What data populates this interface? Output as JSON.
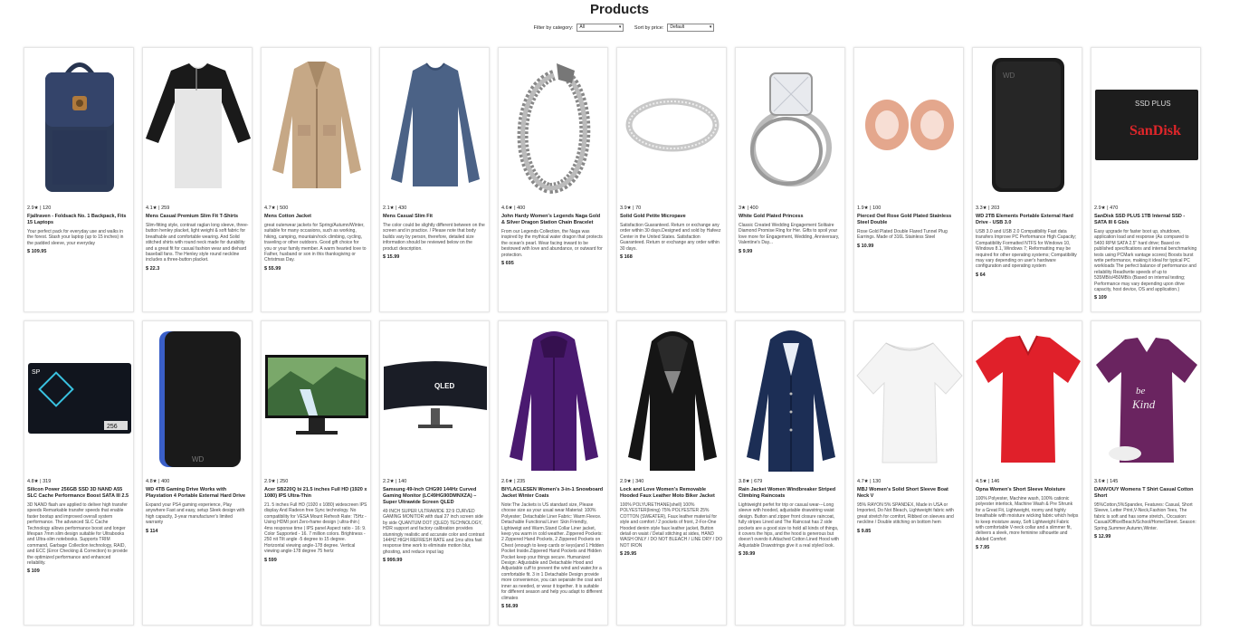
{
  "page": {
    "title": "Products"
  },
  "filters": {
    "category_label": "Filter by category:",
    "category_value": "All",
    "sort_label": "Sort by price:",
    "sort_value": "Default"
  },
  "products": [
    {
      "rating": "2.9★",
      "reviews": "120",
      "title": "Fjallraven - Foldsack No. 1 Backpack, Fits 15 Laptops",
      "desc": "Your perfect pack for everyday use and walks in the forest. Stash your laptop (up to 15 inches) in the padded sleeve, your everyday",
      "price": "$ 109.95",
      "img": "backpack"
    },
    {
      "rating": "4.1★",
      "reviews": "259",
      "title": "Mens Casual Premium Slim Fit T-Shirts",
      "desc": "Slim-fitting style, contrast raglan long sleeve, three-button henley placket, light weight & soft fabric for breathable and comfortable wearing. And Solid stitched shirts with round neck made for durability and a great fit for casual fashion wear and diehard baseball fans. The Henley style round neckline includes a three-button placket.",
      "price": "$ 22.3",
      "img": "raglan"
    },
    {
      "rating": "4.7★",
      "reviews": "500",
      "title": "Mens Cotton Jacket",
      "desc": "great outerwear jackets for Spring/Autumn/Winter, suitable for many occasions, such as working, hiking, camping, mountain/rock climbing, cycling, traveling or other outdoors. Good gift choice for you or your family member. A warm hearted love to Father, husband or son in this thanksgiving or Christmas Day.",
      "price": "$ 55.99",
      "img": "jacket"
    },
    {
      "rating": "2.1★",
      "reviews": "430",
      "title": "Mens Casual Slim Fit",
      "desc": "The color could be slightly different between on the screen and in practice. / Please note that body builds vary by person, therefore, detailed size information should be reviewed below on the product description.",
      "price": "$ 15.99",
      "img": "longsleeve"
    },
    {
      "rating": "4.6★",
      "reviews": "400",
      "title": "John Hardy Women's Legends Naga Gold & Silver Dragon Station Chain Bracelet",
      "desc": "From our Legends Collection, the Naga was inspired by the mythical water dragon that protects the ocean's pearl. Wear facing inward to be bestowed with love and abundance, or outward for protection.",
      "price": "$ 695",
      "img": "bracelet"
    },
    {
      "rating": "3.9★",
      "reviews": "70",
      "title": "Solid Gold Petite Micropave",
      "desc": "Satisfaction Guaranteed. Return or exchange any order within 30 days.Designed and sold by Hafeez Center in the United States. Satisfaction Guaranteed. Return or exchange any order within 30 days.",
      "price": "$ 168",
      "img": "ring"
    },
    {
      "rating": "3★",
      "reviews": "400",
      "title": "White Gold Plated Princess",
      "desc": "Classic Created Wedding Engagement Solitaire Diamond Promise Ring for Her. Gifts to spoil your love more for Engagement, Wedding, Anniversary, Valentine's Day...",
      "price": "$ 9.99",
      "img": "princess"
    },
    {
      "rating": "1.9★",
      "reviews": "100",
      "title": "Pierced Owl Rose Gold Plated Stainless Steel Double",
      "desc": "Rose Gold Plated Double Flared Tunnel Plug Earrings. Made of 316L Stainless Steel",
      "price": "$ 10.99",
      "img": "plugs"
    },
    {
      "rating": "3.3★",
      "reviews": "203",
      "title": "WD 2TB Elements Portable External Hard Drive - USB 3.0",
      "desc": "USB 3.0 and USB 2.0 Compatibility Fast data transfers Improve PC Performance High Capacity; Compatibility Formatted NTFS for Windows 10, Windows 8.1, Windows 7; Reformatting may be required for other operating systems; Compatibility may vary depending on user's hardware configuration and operating system",
      "price": "$ 64",
      "img": "wdblack"
    },
    {
      "rating": "2.9★",
      "reviews": "470",
      "title": "SanDisk SSD PLUS 1TB Internal SSD - SATA III 6 Gb/s",
      "desc": "Easy upgrade for faster boot up, shutdown, application load and response (As compared to 5400 RPM SATA 2.5\" hard drive; Based on published specifications and internal benchmarking tests using PCMark vantage scores) Boosts burst write performance, making it ideal for typical PC workloads The perfect balance of performance and reliability Read/write speeds of up to 535MB/s/450MB/s (Based on internal testing; Performance may vary depending upon drive capacity, host device, OS and application.)",
      "price": "$ 109",
      "img": "sandisk"
    },
    {
      "rating": "4.8★",
      "reviews": "319",
      "title": "Silicon Power 256GB SSD 3D NAND A55 SLC Cache Performance Boost SATA III 2.5",
      "desc": "3D NAND flash are applied to deliver high transfer speeds Remarkable transfer speeds that enable faster bootup and improved overall system performance. The advanced SLC Cache Technology allows performance boost and longer lifespan 7mm slim design suitable for Ultrabooks and Ultra-slim notebooks. Supports TRIM command, Garbage Collection technology, RAID, and ECC (Error Checking & Correction) to provide the optimized performance and enhanced reliability.",
      "price": "$ 109",
      "img": "spssd"
    },
    {
      "rating": "4.8★",
      "reviews": "400",
      "title": "WD 4TB Gaming Drive Works with Playstation 4 Portable External Hard Drive",
      "desc": "Expand your PS4 gaming experience, Play anywhere Fast and easy, setup Sleek design with high capacity, 3-year manufacturer's limited warranty",
      "price": "$ 114",
      "img": "wdblue"
    },
    {
      "rating": "2.9★",
      "reviews": "250",
      "title": "Acer SB220Q bi 21.5 inches Full HD (1920 x 1080) IPS Ultra-Thin",
      "desc": "21. 5 inches Full HD (1920 x 1080) widescreen IPS display And Radeon free Sync technology. No compatibility for VESA Mount Refresh Rate: 75Hz - Using HDMI port Zero-frame design | ultra-thin | 4ms response time | IPS panel Aspect ratio - 16: 9. Color Supported - 16. 7 million colors. Brightness - 250 nit Tilt angle -5 degree to 15 degree. Horizontal viewing angle-178 degree. Vertical viewing angle-178 degree 75 hertz",
      "price": "$ 599",
      "img": "monitor"
    },
    {
      "rating": "2.2★",
      "reviews": "140",
      "title": "Samsung 49-Inch CHG90 144Hz Curved Gaming Monitor (LC49HG90DMNXZA) – Super Ultrawide Screen QLED",
      "desc": "49 INCH SUPER ULTRAWIDE 32:9 CURVED GAMING MONITOR with dual 27 inch screen side by side QUANTUM DOT (QLED) TECHNOLOGY, HDR support and factory calibration provides stunningly realistic and accurate color and contrast 144HZ HIGH REFRESH RATE and 1ms ultra fast response time work to eliminate motion blur, ghosting, and reduce input lag",
      "price": "$ 999.99",
      "img": "curved"
    },
    {
      "rating": "2.6★",
      "reviews": "235",
      "title": "BIYLACLESEN Women's 3-in-1 Snowboard Jacket Winter Coats",
      "desc": "Note:The Jackets is US standard size, Please choose size as your usual wear Material: 100% Polyester; Detachable Liner Fabric: Warm Fleece. Detachable Functional Liner: Skin Friendly, Lightweigt and Warm.Stand Collar Liner jacket, keep you warm in cold weather. Zippered Pockets: 2 Zippered Hand Pockets, 2 Zippered Pockets on Chest (enough to keep cards or keys)and 1 Hidden Pocket Inside.Zippered Hand Pockets and Hidden Pocket keep your things secure. Humanized Design: Adjustable and Detachable Hood and Adjustable cuff to prevent the wind and water,for a comfortable fit. 3 in 1 Detachable Design provide more convenience, you can separate the coat and inner as needed, or wear it together. It is suitable for different season and help you adapt to different climates",
      "price": "$ 56.99",
      "img": "purplecoat"
    },
    {
      "rating": "2.9★",
      "reviews": "340",
      "title": "Lock and Love Women's Removable Hooded Faux Leather Moto Biker Jacket",
      "desc": "100% POLYURETHANE(shell) 100% POLYESTER(lining) 75% POLYESTER 25% COTTON (SWEATER), Faux leather material for style and comfort / 2 pockets of front, 2-For-One Hooded denim style faux leather jacket, Button detail on waist / Detail stitching at sides, HAND WASH ONLY / DO NOT BLEACH / LINE DRY / DO NOT IRON",
      "price": "$ 29.95",
      "img": "leather"
    },
    {
      "rating": "3.8★",
      "reviews": "679",
      "title": "Rain Jacket Women Windbreaker Striped Climbing Raincoats",
      "desc": "Lightweight perfet for trip or casual wear---Long sleeve with hooded, adjustable drawstring waist design. Button and zipper front closure raincoat, fully stripes Lined and The Raincoat has 2 side pockets are a good size to hold all kinds of things, it covers the hips, and the hood is generous but doesn't overdo it.Attached Cotton Lined Hood with Adjustable Drawstrings give it a real styled look.",
      "price": "$ 39.99",
      "img": "raincoat"
    },
    {
      "rating": "4.7★",
      "reviews": "130",
      "title": "MBJ Women's Solid Short Sleeve Boat Neck V",
      "desc": "95% RAYON 5% SPANDEX, Made in USA or Imported, Do Not Bleach, Lightweight fabric with great stretch for comfort, Ribbed on sleeves and neckline / Double stitching on bottom hem",
      "price": "$ 9.85",
      "img": "whitetee"
    },
    {
      "rating": "4.5★",
      "reviews": "146",
      "title": "Opna Women's Short Sleeve Moisture",
      "desc": "100% Polyester, Machine wash, 100% cationic polyester interlock, Machine Wash & Pre Shrunk for a Great Fit, Lightweight, roomy and highly breathable with moisture wicking fabric which helps to keep moisture away, Soft Lightweight Fabric with comfortable V-neck collar and a slimmer fit, delivers a sleek, more feminine silhouette and Added Comfort",
      "price": "$ 7.95",
      "img": "redtee"
    },
    {
      "rating": "3.6★",
      "reviews": "145",
      "title": "DANVOUY Womens T Shirt Casual Cotton Short",
      "desc": "95%Cotton,5%Spandex, Features: Casual, Short Sleeve, Letter Print,V-Neck,Fashion Tees, The fabric is soft and has some stretch., Occasion: Casual/Office/Beach/School/Home/Street. Season: Spring,Summer,Autumn,Winter.",
      "price": "$ 12.99",
      "img": "plumtee"
    }
  ]
}
